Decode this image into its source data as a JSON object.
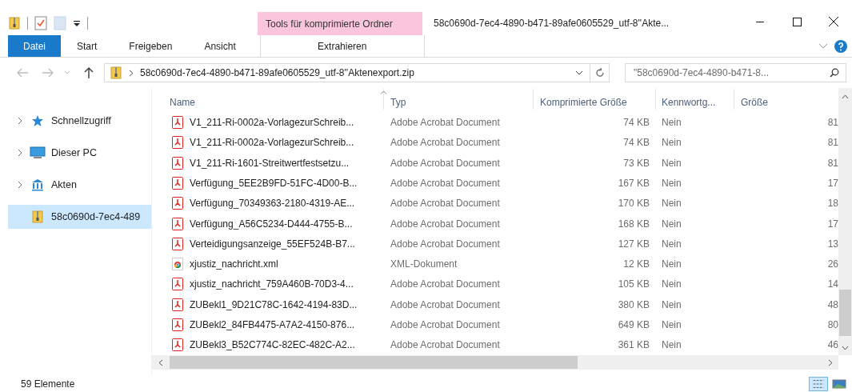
{
  "window": {
    "title": "58c0690d-7ec4-4890-b471-89afe0605529_utf-8''Akte..."
  },
  "context_tab_group": "Tools für komprimierte Ordner",
  "ribbon_tabs": [
    {
      "label": "Datei",
      "selected": false,
      "kind": "file"
    },
    {
      "label": "Start",
      "selected": false,
      "kind": "tab"
    },
    {
      "label": "Freigeben",
      "selected": false,
      "kind": "tab"
    },
    {
      "label": "Ansicht",
      "selected": false,
      "kind": "tab"
    },
    {
      "label": "Extrahieren",
      "selected": false,
      "kind": "context"
    }
  ],
  "address_bar": {
    "path": "58c0690d-7ec4-4890-b471-89afe0605529_utf-8''Aktenexport.zip"
  },
  "search": {
    "placeholder": "\"58c0690d-7ec4-4890-b471-8..."
  },
  "sidebar": {
    "items": [
      {
        "label": "Schnellzugriff",
        "kind": "star",
        "selected": false
      },
      {
        "label": "Dieser PC",
        "kind": "pc",
        "selected": false
      },
      {
        "label": "Akten",
        "kind": "library",
        "selected": false
      },
      {
        "label": "58c0690d-7ec4-489",
        "kind": "zip",
        "selected": true
      }
    ]
  },
  "table": {
    "columns": [
      "Name",
      "Typ",
      "Komprimierte Größe",
      "Kennwortg...",
      "Größe"
    ],
    "rows": [
      {
        "kind": "pdf",
        "name": "V1_211-Ri-0002a-VorlagezurSchreib...",
        "type": "Adobe Acrobat Document",
        "compressed": "74 KB",
        "password": "Nein",
        "size": "81"
      },
      {
        "kind": "pdf",
        "name": "V1_211-Ri-0002a-VorlagezurSchreib...",
        "type": "Adobe Acrobat Document",
        "compressed": "74 KB",
        "password": "Nein",
        "size": "81"
      },
      {
        "kind": "pdf",
        "name": "V1_211-Ri-1601-Streitwertfestsetzu...",
        "type": "Adobe Acrobat Document",
        "compressed": "73 KB",
        "password": "Nein",
        "size": "81"
      },
      {
        "kind": "pdf",
        "name": "Verfügung_5EE2B9FD-51FC-4D00-B...",
        "type": "Adobe Acrobat Document",
        "compressed": "167 KB",
        "password": "Nein",
        "size": "17"
      },
      {
        "kind": "pdf",
        "name": "Verfügung_70349363-2180-4319-AE...",
        "type": "Adobe Acrobat Document",
        "compressed": "170 KB",
        "password": "Nein",
        "size": "18"
      },
      {
        "kind": "pdf",
        "name": "Verfügung_A56C5234-D444-4755-B...",
        "type": "Adobe Acrobat Document",
        "compressed": "168 KB",
        "password": "Nein",
        "size": "17"
      },
      {
        "kind": "pdf",
        "name": "Verteidigungsanzeige_55EF524B-B7...",
        "type": "Adobe Acrobat Document",
        "compressed": "127 KB",
        "password": "Nein",
        "size": "13"
      },
      {
        "kind": "xml",
        "name": "xjustiz_nachricht.xml",
        "type": "XML-Dokument",
        "compressed": "12 KB",
        "password": "Nein",
        "size": "26"
      },
      {
        "kind": "pdf",
        "name": "xjustiz_nachricht_759A460B-70D3-4...",
        "type": "Adobe Acrobat Document",
        "compressed": "105 KB",
        "password": "Nein",
        "size": "14"
      },
      {
        "kind": "pdf",
        "name": "ZUBekl1_9D21C78C-1642-4194-83D...",
        "type": "Adobe Acrobat Document",
        "compressed": "380 KB",
        "password": "Nein",
        "size": "48"
      },
      {
        "kind": "pdf",
        "name": "ZUBekl2_84FB4475-A7A2-4150-876...",
        "type": "Adobe Acrobat Document",
        "compressed": "649 KB",
        "password": "Nein",
        "size": "80"
      },
      {
        "kind": "pdf",
        "name": "ZUBekl3_B52C774C-82EC-482C-A2...",
        "type": "Adobe Acrobat Document",
        "compressed": "361 KB",
        "password": "Nein",
        "size": "46"
      }
    ]
  },
  "status_bar": {
    "count": "59 Elemente"
  }
}
